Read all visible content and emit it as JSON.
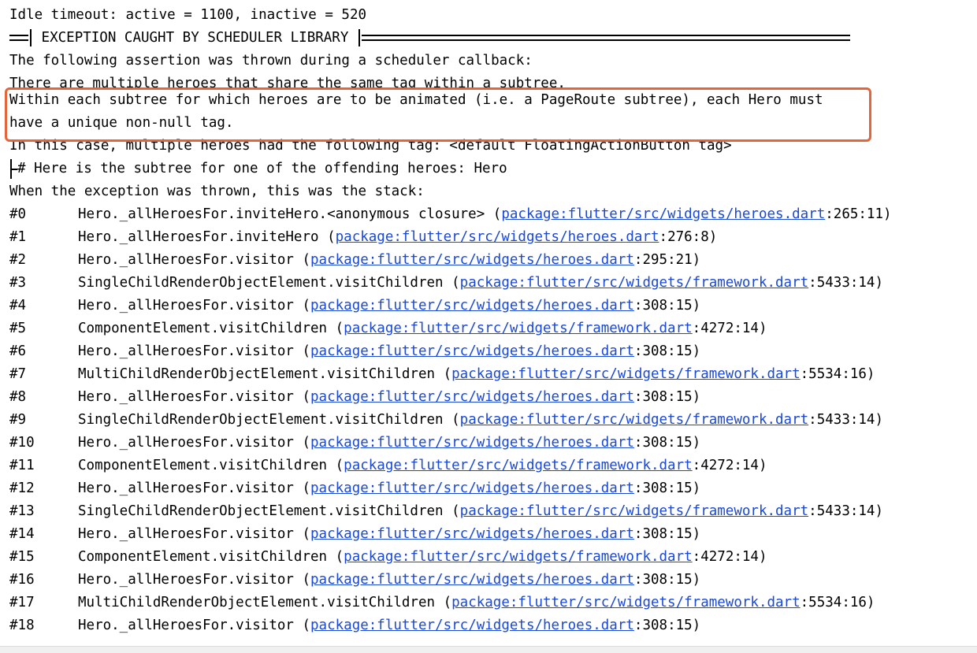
{
  "console": {
    "idle_line": "Idle timeout: active = 1100, inactive = 520",
    "banner_text": "EXCEPTION CAUGHT BY SCHEDULER LIBRARY",
    "assertion_line": "The following assertion was thrown during a scheduler callback:",
    "multiple_heroes_line": "There are multiple heroes that share the same tag within a subtree.",
    "highlight_line_1": "Within each subtree for which heroes are to be animated (i.e. a PageRoute subtree), each Hero must",
    "highlight_line_2": "have a unique non-null tag.",
    "tag_line": "In this case, multiple heroes had the following tag: <default FloatingActionButton tag>",
    "subtree_line": "# Here is the subtree for one of the offending heroes: Hero",
    "stack_intro": "When the exception was thrown, this was the stack:"
  },
  "highlight": {
    "border_color": "#e5643a"
  },
  "stack": [
    {
      "num": "#0",
      "func": "Hero._allHeroesFor.inviteHero.<anonymous closure> (",
      "link": "package:flutter/src/widgets/heroes.dart",
      "loc": ":265:11)"
    },
    {
      "num": "#1",
      "func": "Hero._allHeroesFor.inviteHero (",
      "link": "package:flutter/src/widgets/heroes.dart",
      "loc": ":276:8)"
    },
    {
      "num": "#2",
      "func": "Hero._allHeroesFor.visitor (",
      "link": "package:flutter/src/widgets/heroes.dart",
      "loc": ":295:21)"
    },
    {
      "num": "#3",
      "func": "SingleChildRenderObjectElement.visitChildren (",
      "link": "package:flutter/src/widgets/framework.dart",
      "loc": ":5433:14)"
    },
    {
      "num": "#4",
      "func": "Hero._allHeroesFor.visitor (",
      "link": "package:flutter/src/widgets/heroes.dart",
      "loc": ":308:15)"
    },
    {
      "num": "#5",
      "func": "ComponentElement.visitChildren (",
      "link": "package:flutter/src/widgets/framework.dart",
      "loc": ":4272:14)"
    },
    {
      "num": "#6",
      "func": "Hero._allHeroesFor.visitor (",
      "link": "package:flutter/src/widgets/heroes.dart",
      "loc": ":308:15)"
    },
    {
      "num": "#7",
      "func": "MultiChildRenderObjectElement.visitChildren (",
      "link": "package:flutter/src/widgets/framework.dart",
      "loc": ":5534:16)"
    },
    {
      "num": "#8",
      "func": "Hero._allHeroesFor.visitor (",
      "link": "package:flutter/src/widgets/heroes.dart",
      "loc": ":308:15)"
    },
    {
      "num": "#9",
      "func": "SingleChildRenderObjectElement.visitChildren (",
      "link": "package:flutter/src/widgets/framework.dart",
      "loc": ":5433:14)"
    },
    {
      "num": "#10",
      "func": "Hero._allHeroesFor.visitor (",
      "link": "package:flutter/src/widgets/heroes.dart",
      "loc": ":308:15)"
    },
    {
      "num": "#11",
      "func": "ComponentElement.visitChildren (",
      "link": "package:flutter/src/widgets/framework.dart",
      "loc": ":4272:14)"
    },
    {
      "num": "#12",
      "func": "Hero._allHeroesFor.visitor (",
      "link": "package:flutter/src/widgets/heroes.dart",
      "loc": ":308:15)"
    },
    {
      "num": "#13",
      "func": "SingleChildRenderObjectElement.visitChildren (",
      "link": "package:flutter/src/widgets/framework.dart",
      "loc": ":5433:14)"
    },
    {
      "num": "#14",
      "func": "Hero._allHeroesFor.visitor (",
      "link": "package:flutter/src/widgets/heroes.dart",
      "loc": ":308:15)"
    },
    {
      "num": "#15",
      "func": "ComponentElement.visitChildren (",
      "link": "package:flutter/src/widgets/framework.dart",
      "loc": ":4272:14)"
    },
    {
      "num": "#16",
      "func": "Hero._allHeroesFor.visitor (",
      "link": "package:flutter/src/widgets/heroes.dart",
      "loc": ":308:15)"
    },
    {
      "num": "#17",
      "func": "MultiChildRenderObjectElement.visitChildren (",
      "link": "package:flutter/src/widgets/framework.dart",
      "loc": ":5534:16)"
    },
    {
      "num": "#18",
      "func": "Hero._allHeroesFor.visitor (",
      "link": "package:flutter/src/widgets/heroes.dart",
      "loc": ":308:15)"
    }
  ]
}
